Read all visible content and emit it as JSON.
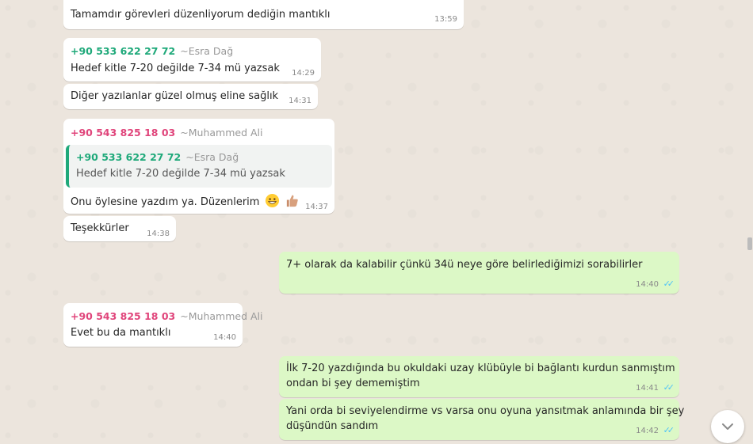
{
  "messages": [
    {
      "text": "Tamamdır görevleri düzenliyorum dediğin mantıklı",
      "time": "13:59"
    },
    {
      "sender_number": "+90 533 622 27 72",
      "sender_name": "~Esra Dağ",
      "text": "Hedef kitle 7-20 değilde 7-34 mü yazsak",
      "time": "14:29"
    },
    {
      "text": "Diğer yazılanlar güzel olmuş eline sağlık",
      "time": "14:31"
    },
    {
      "sender_number": "+90 543 825 18 03",
      "sender_name": "~Muhammed Ali",
      "quote": {
        "sender_number": "+90 533 622 27 72",
        "sender_name": "~Esra Dağ",
        "text": "Hedef kitle 7-20 değilde 7-34 mü yazsak"
      },
      "text": "Onu öylesine yazdım ya. Düzenlerim",
      "emojis": [
        "grinning-face",
        "thumbs-up"
      ],
      "time": "14:37"
    },
    {
      "text": "Teşekkürler",
      "time": "14:38"
    },
    {
      "text": "7+ olarak da kalabilir çünkü 34ü neye göre belirlediğimizi sorabilirler",
      "time": "14:40",
      "ticks": "✓✓"
    },
    {
      "sender_number": "+90 543 825 18 03",
      "sender_name": "~Muhammed Ali",
      "text": "Evet bu da mantıklı",
      "time": "14:40"
    },
    {
      "text_line1": "İlk 7-20 yazdığında bu okuldaki uzay klübüyle bi bağlantı kurdun sanmıştım",
      "text_line2": "ondan bi şey dememiştim",
      "time": "14:41",
      "ticks": "✓✓"
    },
    {
      "text_line1": "Yani orda bi seviyelendirme vs varsa onu oyuna yansıtmak anlamında bir şey",
      "text_line2": "düşündün sandım",
      "time": "14:42",
      "ticks": "✓✓"
    }
  ],
  "colors": {
    "incoming": "#ffffff",
    "outgoing": "#dcf8c6",
    "sender_green": "#1fa97a",
    "sender_pink": "#e0457b",
    "read_ticks": "#4fc3f7"
  },
  "controls": {
    "scroll_down_icon": "chevron-down-icon"
  }
}
